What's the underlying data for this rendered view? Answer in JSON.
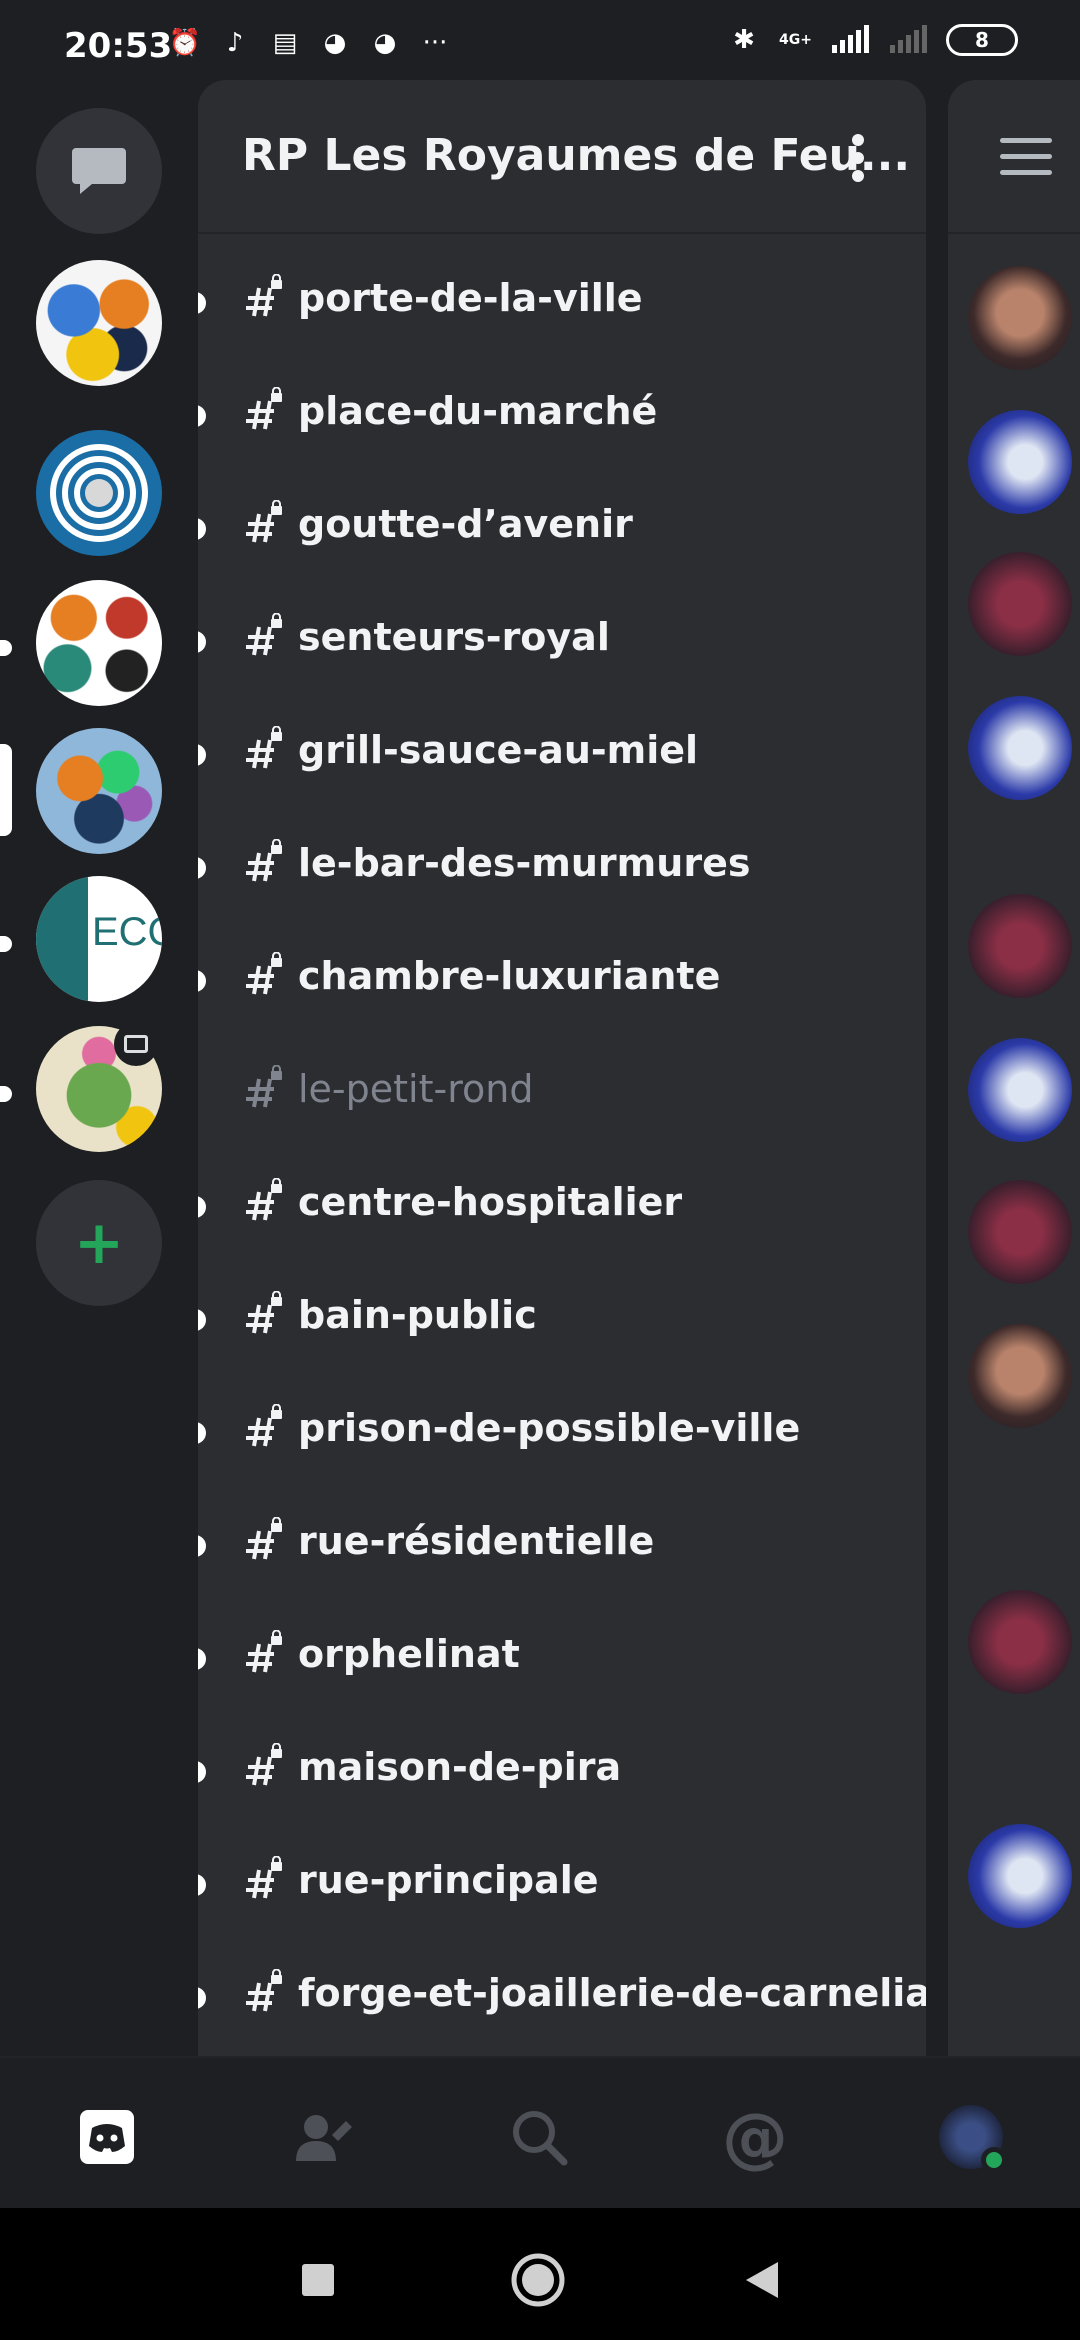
{
  "status_bar": {
    "time": "20:53",
    "battery": "8",
    "icons": [
      "alarm-icon",
      "tiktok-icon",
      "news-icon",
      "discord-icon",
      "discord-icon",
      "more-dots-icon"
    ],
    "network_label": "4G+"
  },
  "server": {
    "name": "RP Les Royaumes de Feu..."
  },
  "channels": [
    {
      "name": "porte-de-la-ville",
      "unread": true
    },
    {
      "name": "place-du-marché",
      "unread": true
    },
    {
      "name": "goutte-d’avenir",
      "unread": true
    },
    {
      "name": "senteurs-royal",
      "unread": true
    },
    {
      "name": "grill-sauce-au-miel",
      "unread": true
    },
    {
      "name": "le-bar-des-murmures",
      "unread": true
    },
    {
      "name": "chambre-luxuriante",
      "unread": true
    },
    {
      "name": "le-petit-rond",
      "unread": false
    },
    {
      "name": "centre-hospitalier",
      "unread": true
    },
    {
      "name": "bain-public",
      "unread": true
    },
    {
      "name": "prison-de-possible-ville",
      "unread": true
    },
    {
      "name": "rue-résidentielle",
      "unread": true
    },
    {
      "name": "orphelinat",
      "unread": true
    },
    {
      "name": "maison-de-pira",
      "unread": true
    },
    {
      "name": "rue-principale",
      "unread": true
    },
    {
      "name": "forge-et-joaillerie-de-carnelian",
      "unread": true
    }
  ],
  "guilds": [
    {
      "name": "dragons-server"
    },
    {
      "name": "maze-server"
    },
    {
      "name": "dragons-circle-server"
    },
    {
      "name": "dragons-colorful-server"
    },
    {
      "name": "eco-server"
    },
    {
      "name": "cactus-server"
    }
  ],
  "bottom_nav": [
    "home-tab",
    "friends-tab",
    "search-tab",
    "mentions-tab",
    "profile-tab"
  ],
  "colors": {
    "accent": "#5865f2",
    "add_server": "#23a55a",
    "online": "#23a55a"
  }
}
